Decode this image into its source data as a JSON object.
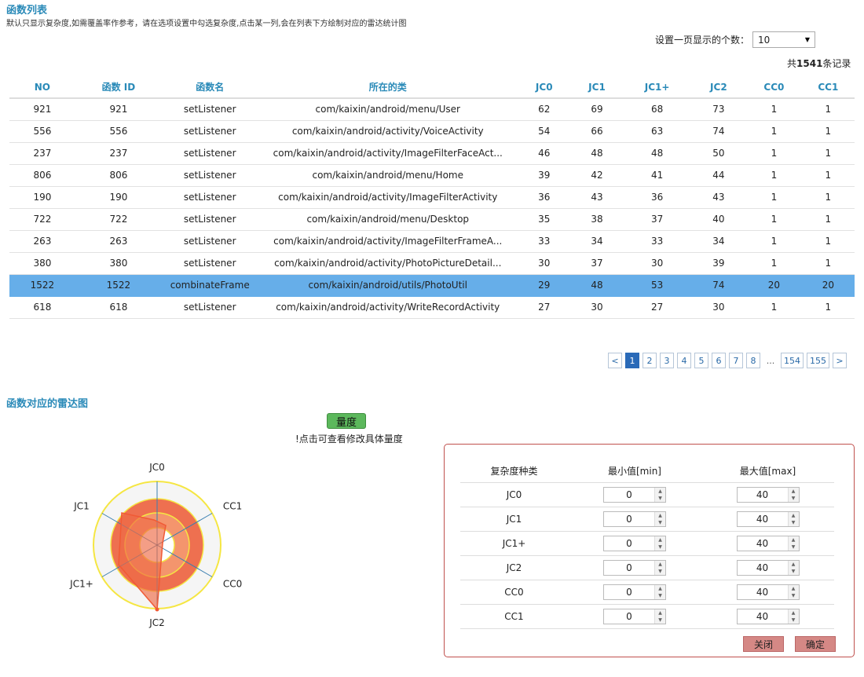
{
  "header": {
    "title": "函数列表",
    "hint": "默认只显示复杂度,如需覆盖率作参考，请在选项设置中勾选复杂度,点击某一列,会在列表下方绘制对应的雷达统计图"
  },
  "per_page": {
    "label": "设置一页显示的个数：",
    "value": "10"
  },
  "total": {
    "prefix": "共",
    "count": "1541",
    "suffix": "条记录"
  },
  "table": {
    "columns": [
      "NO",
      "函数 ID",
      "函数名",
      "所在的类",
      "JC0",
      "JC1",
      "JC1+",
      "JC2",
      "CC0",
      "CC1"
    ],
    "rows": [
      [
        "921",
        "921",
        "setListener",
        "com/kaixin/android/menu/User",
        "62",
        "69",
        "68",
        "73",
        "1",
        "1"
      ],
      [
        "556",
        "556",
        "setListener",
        "com/kaixin/android/activity/VoiceActivity",
        "54",
        "66",
        "63",
        "74",
        "1",
        "1"
      ],
      [
        "237",
        "237",
        "setListener",
        "com/kaixin/android/activity/ImageFilterFaceAct...",
        "46",
        "48",
        "48",
        "50",
        "1",
        "1"
      ],
      [
        "806",
        "806",
        "setListener",
        "com/kaixin/android/menu/Home",
        "39",
        "42",
        "41",
        "44",
        "1",
        "1"
      ],
      [
        "190",
        "190",
        "setListener",
        "com/kaixin/android/activity/ImageFilterActivity",
        "36",
        "43",
        "36",
        "43",
        "1",
        "1"
      ],
      [
        "722",
        "722",
        "setListener",
        "com/kaixin/android/menu/Desktop",
        "35",
        "38",
        "37",
        "40",
        "1",
        "1"
      ],
      [
        "263",
        "263",
        "setListener",
        "com/kaixin/android/activity/ImageFilterFrameA...",
        "33",
        "34",
        "33",
        "34",
        "1",
        "1"
      ],
      [
        "380",
        "380",
        "setListener",
        "com/kaixin/android/activity/PhotoPictureDetail...",
        "30",
        "37",
        "30",
        "39",
        "1",
        "1"
      ],
      [
        "1522",
        "1522",
        "combinateFrame",
        "com/kaixin/android/utils/PhotoUtil",
        "29",
        "48",
        "53",
        "74",
        "20",
        "20"
      ],
      [
        "618",
        "618",
        "setListener",
        "com/kaixin/android/activity/WriteRecordActivity",
        "27",
        "30",
        "27",
        "30",
        "1",
        "1"
      ]
    ],
    "selected_row": 8
  },
  "pager": {
    "prev": "<",
    "pages": [
      "1",
      "2",
      "3",
      "4",
      "5",
      "6",
      "7",
      "8"
    ],
    "active": "1",
    "dots": "...",
    "tail": [
      "154",
      "155"
    ],
    "next": ">"
  },
  "radar_section": {
    "title": "函数对应的雷达图",
    "button": "量度",
    "note": "!点击可查看修改具体量度",
    "axes": [
      "JC0",
      "CC1",
      "CC0",
      "JC2",
      "JC1+",
      "JC1"
    ]
  },
  "range_panel": {
    "headers": [
      "复杂度种类",
      "最小值[min]",
      "最大值[max]"
    ],
    "rows": [
      {
        "name": "JC0",
        "min": "0",
        "max": "40"
      },
      {
        "name": "JC1",
        "min": "0",
        "max": "40"
      },
      {
        "name": "JC1+",
        "min": "0",
        "max": "40"
      },
      {
        "name": "JC2",
        "min": "0",
        "max": "40"
      },
      {
        "name": "CC0",
        "min": "0",
        "max": "40"
      },
      {
        "name": "CC1",
        "min": "0",
        "max": "40"
      }
    ],
    "close": "关闭",
    "confirm": "确定"
  }
}
